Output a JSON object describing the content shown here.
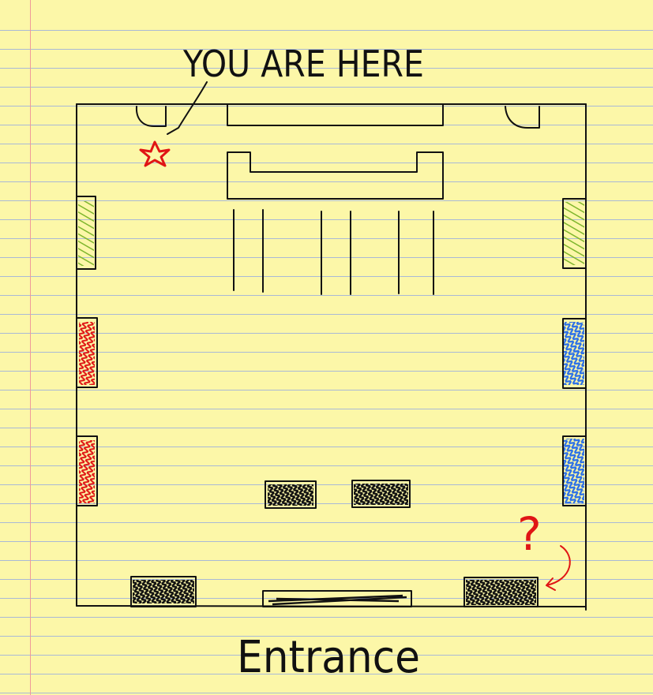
{
  "labels": {
    "you_are_here": "YOU ARE HERE",
    "entrance": "Entrance",
    "question_mark": "?"
  },
  "colors": {
    "paper": "#fcf7a8",
    "rule_line": "#a9b9d6",
    "margin_line": "#ef9a9a",
    "ink": "#111111",
    "star": "#e01515",
    "green_shelf": "#7fb62d",
    "red_shelf": "#e01515",
    "blue_shelf": "#2a6fe8",
    "black_fill": "#111111",
    "question_mark": "#e01515"
  },
  "icons": {
    "you_are_here_marker": "star-icon",
    "pointer_arrow": "curved-arrow-icon"
  }
}
